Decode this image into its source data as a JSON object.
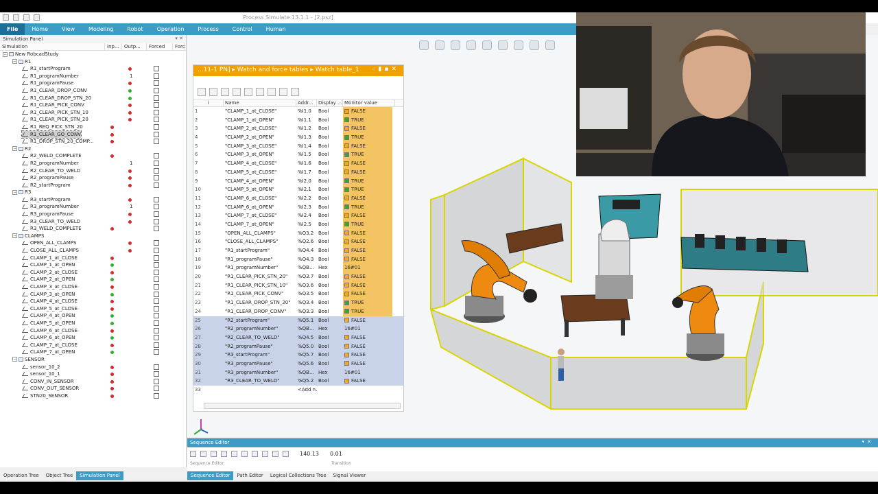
{
  "window": {
    "title": "Process Simulate 13.1.1 - [2.psz]"
  },
  "ribbon": {
    "tabs": [
      "File",
      "Home",
      "View",
      "Modeling",
      "Robot",
      "Operation",
      "Process",
      "Control",
      "Human"
    ]
  },
  "sim_panel": {
    "title": "Simulation Panel",
    "columns": [
      "Simulation",
      "Inp...",
      "Outp...",
      "Forced",
      "Forc"
    ],
    "rows": [
      {
        "label": "New RobcadStudy",
        "kind": "root",
        "indent": 0
      },
      {
        "label": "R1",
        "kind": "group",
        "indent": 1
      },
      {
        "label": "R1_startProgram",
        "kind": "sig",
        "indent": 2,
        "out": "red"
      },
      {
        "label": "R1_programNumber",
        "kind": "sig",
        "indent": 2,
        "num": "1"
      },
      {
        "label": "R1_programPause",
        "kind": "sig",
        "indent": 2,
        "out": "red"
      },
      {
        "label": "R1_CLEAR_DROP_CONV",
        "kind": "sig",
        "indent": 2,
        "out": "green"
      },
      {
        "label": "R1_CLEAR_DROP_STN_20",
        "kind": "sig",
        "indent": 2,
        "out": "green"
      },
      {
        "label": "R1_CLEAR_PICK_CONV",
        "kind": "sig",
        "indent": 2,
        "out": "red"
      },
      {
        "label": "R1_CLEAR_PICK_STN_10",
        "kind": "sig",
        "indent": 2,
        "out": "red"
      },
      {
        "label": "R1_CLEAR_PICK_STN_20",
        "kind": "sig",
        "indent": 2,
        "out": "red"
      },
      {
        "label": "R1_REQ_PICK_STN_20",
        "kind": "sig",
        "indent": 2,
        "in": "red"
      },
      {
        "label": "R1_CLEAR_GO_CONV",
        "kind": "sig",
        "indent": 2,
        "in": "red",
        "hl": true
      },
      {
        "label": "R1_DROP_STN_20_COMP...",
        "kind": "sig",
        "indent": 2,
        "in": "red"
      },
      {
        "label": "R2",
        "kind": "group",
        "indent": 1
      },
      {
        "label": "R2_WELD_COMPLETE",
        "kind": "sig",
        "indent": 2,
        "in": "red"
      },
      {
        "label": "R2_programNumber",
        "kind": "sig",
        "indent": 2,
        "num": "1"
      },
      {
        "label": "R2_CLEAR_TO_WELD",
        "kind": "sig",
        "indent": 2,
        "out": "red"
      },
      {
        "label": "R2_programPause",
        "kind": "sig",
        "indent": 2,
        "out": "red"
      },
      {
        "label": "R2_startProgram",
        "kind": "sig",
        "indent": 2,
        "out": "red"
      },
      {
        "label": "R3",
        "kind": "group",
        "indent": 1
      },
      {
        "label": "R3_startProgram",
        "kind": "sig",
        "indent": 2,
        "out": "red"
      },
      {
        "label": "R3_programNumber",
        "kind": "sig",
        "indent": 2,
        "num": "1"
      },
      {
        "label": "R3_programPause",
        "kind": "sig",
        "indent": 2,
        "out": "red"
      },
      {
        "label": "R3_CLEAR_TO_WELD",
        "kind": "sig",
        "indent": 2,
        "out": "red"
      },
      {
        "label": "R3_WELD_COMPLETE",
        "kind": "sig",
        "indent": 2,
        "in": "red"
      },
      {
        "label": "CLAMPS",
        "kind": "group",
        "indent": 1
      },
      {
        "label": "OPEN_ALL_CLAMPS",
        "kind": "sig",
        "indent": 2,
        "out": "red"
      },
      {
        "label": "CLOSE_ALL_CLAMPS",
        "kind": "sig",
        "indent": 2,
        "out": "red"
      },
      {
        "label": "CLAMP_1_at_CLOSE",
        "kind": "sig",
        "indent": 2,
        "in": "red"
      },
      {
        "label": "CLAMP_1_at_OPEN",
        "kind": "sig",
        "indent": 2,
        "in": "green"
      },
      {
        "label": "CLAMP_2_at_CLOSE",
        "kind": "sig",
        "indent": 2,
        "in": "red"
      },
      {
        "label": "CLAMP_2_at_OPEN",
        "kind": "sig",
        "indent": 2,
        "in": "green"
      },
      {
        "label": "CLAMP_3_at_CLOSE",
        "kind": "sig",
        "indent": 2,
        "in": "red"
      },
      {
        "label": "CLAMP_3_at_OPEN",
        "kind": "sig",
        "indent": 2,
        "in": "green"
      },
      {
        "label": "CLAMP_4_at_CLOSE",
        "kind": "sig",
        "indent": 2,
        "in": "red"
      },
      {
        "label": "CLAMP_5_at_CLOSE",
        "kind": "sig",
        "indent": 2,
        "in": "red"
      },
      {
        "label": "CLAMP_4_at_OPEN",
        "kind": "sig",
        "indent": 2,
        "in": "green"
      },
      {
        "label": "CLAMP_5_at_OPEN",
        "kind": "sig",
        "indent": 2,
        "in": "green"
      },
      {
        "label": "CLAMP_6_at_CLOSE",
        "kind": "sig",
        "indent": 2,
        "in": "red"
      },
      {
        "label": "CLAMP_6_at_OPEN",
        "kind": "sig",
        "indent": 2,
        "in": "green"
      },
      {
        "label": "CLAMP_7_at_CLOSE",
        "kind": "sig",
        "indent": 2,
        "in": "red"
      },
      {
        "label": "CLAMP_7_at_OPEN",
        "kind": "sig",
        "indent": 2,
        "in": "green"
      },
      {
        "label": "SENSOR",
        "kind": "group",
        "indent": 1
      },
      {
        "label": "sensor_10_2",
        "kind": "sig",
        "indent": 2,
        "in": "red"
      },
      {
        "label": "sensor_10_1",
        "kind": "sig",
        "indent": 2,
        "in": "red"
      },
      {
        "label": "CONV_IN_SENSOR",
        "kind": "sig",
        "indent": 2,
        "in": "red"
      },
      {
        "label": "CONV_OUT_SENSOR",
        "kind": "sig",
        "indent": 2,
        "in": "red"
      },
      {
        "label": "STN20_SENSOR",
        "kind": "sig",
        "indent": 2,
        "in": "red"
      }
    ],
    "bottom_tabs": [
      "Operation Tree",
      "Object Tree",
      "Simulation Panel"
    ]
  },
  "watch": {
    "title": "...11-1 PN]  ▸  Watch and force tables  ▸  Watch table_1",
    "columns": [
      "i",
      "Name",
      "Addr...",
      "Display ...",
      "Monitor value"
    ],
    "rows": [
      {
        "i": "1",
        "name": "\"CLAMP_1_at_CLOSE\"",
        "addr": "%I1.0",
        "disp": "Bool",
        "val": "FALSE",
        "style": "orange"
      },
      {
        "i": "2",
        "name": "\"CLAMP_1_at_OPEN\"",
        "addr": "%I1.1",
        "disp": "Bool",
        "val": "TRUE",
        "style": "orange"
      },
      {
        "i": "3",
        "name": "\"CLAMP_2_at_CLOSE\"",
        "addr": "%I1.2",
        "disp": "Bool",
        "val": "FALSE",
        "style": "orange"
      },
      {
        "i": "4",
        "name": "\"CLAMP_2_at_OPEN\"",
        "addr": "%I1.3",
        "disp": "Bool",
        "val": "TRUE",
        "style": "orange"
      },
      {
        "i": "5",
        "name": "\"CLAMP_3_at_CLOSE\"",
        "addr": "%I1.4",
        "disp": "Bool",
        "val": "FALSE",
        "style": "orange"
      },
      {
        "i": "6",
        "name": "\"CLAMP_3_at_OPEN\"",
        "addr": "%I1.5",
        "disp": "Bool",
        "val": "TRUE",
        "style": "orange"
      },
      {
        "i": "7",
        "name": "\"CLAMP_4_at_CLOSE\"",
        "addr": "%I1.6",
        "disp": "Bool",
        "val": "FALSE",
        "style": "orange"
      },
      {
        "i": "8",
        "name": "\"CLAMP_5_at_CLOSE\"",
        "addr": "%I1.7",
        "disp": "Bool",
        "val": "FALSE",
        "style": "orange"
      },
      {
        "i": "9",
        "name": "\"CLAMP_4_at_OPEN\"",
        "addr": "%I2.0",
        "disp": "Bool",
        "val": "TRUE",
        "style": "orange"
      },
      {
        "i": "10",
        "name": "\"CLAMP_5_at_OPEN\"",
        "addr": "%I2.1",
        "disp": "Bool",
        "val": "TRUE",
        "style": "orange"
      },
      {
        "i": "11",
        "name": "\"CLAMP_6_at_CLOSE\"",
        "addr": "%I2.2",
        "disp": "Bool",
        "val": "FALSE",
        "style": "orange"
      },
      {
        "i": "12",
        "name": "\"CLAMP_6_at_OPEN\"",
        "addr": "%I2.3",
        "disp": "Bool",
        "val": "TRUE",
        "style": "orange"
      },
      {
        "i": "13",
        "name": "\"CLAMP_7_at_CLOSE\"",
        "addr": "%I2.4",
        "disp": "Bool",
        "val": "FALSE",
        "style": "orange"
      },
      {
        "i": "14",
        "name": "\"CLAMP_7_at_OPEN\"",
        "addr": "%I2.5",
        "disp": "Bool",
        "val": "TRUE",
        "style": "orange"
      },
      {
        "i": "15",
        "name": "\"OPEN_ALL_CLAMPS\"",
        "addr": "%Q3.2",
        "disp": "Bool",
        "val": "FALSE",
        "style": "orange"
      },
      {
        "i": "16",
        "name": "\"CLOSE_ALL_CLAMPS\"",
        "addr": "%Q2.6",
        "disp": "Bool",
        "val": "FALSE",
        "style": "orange"
      },
      {
        "i": "17",
        "name": "\"R1_startProgram\"",
        "addr": "%Q4.4",
        "disp": "Bool",
        "val": "FALSE",
        "style": "orange"
      },
      {
        "i": "18",
        "name": "\"R1_programPause\"",
        "addr": "%Q4.3",
        "disp": "Bool",
        "val": "FALSE",
        "style": "orange"
      },
      {
        "i": "19",
        "name": "\"R1_programNumber\"",
        "addr": "%QB...",
        "disp": "Hex",
        "val": "16#01",
        "style": "orange"
      },
      {
        "i": "20",
        "name": "\"R1_CLEAR_PICK_STN_20\"",
        "addr": "%Q3.7",
        "disp": "Bool",
        "val": "FALSE",
        "style": "orange"
      },
      {
        "i": "21",
        "name": "\"R1_CLEAR_PICK_STN_10\"",
        "addr": "%Q3.6",
        "disp": "Bool",
        "val": "FALSE",
        "style": "orange"
      },
      {
        "i": "22",
        "name": "\"R1_CLEAR_PICK_CONV\"",
        "addr": "%Q3.5",
        "disp": "Bool",
        "val": "FALSE",
        "style": "orange"
      },
      {
        "i": "23",
        "name": "\"R1_CLEAR_DROP_STN_20\"",
        "addr": "%Q3.4",
        "disp": "Bool",
        "val": "TRUE",
        "style": "orange"
      },
      {
        "i": "24",
        "name": "\"R1_CLEAR_DROP_CONV\"",
        "addr": "%Q3.3",
        "disp": "Bool",
        "val": "TRUE",
        "style": "orange"
      },
      {
        "i": "25",
        "name": "\"R2_startProgram\"",
        "addr": "%Q5.1",
        "disp": "Bool",
        "val": "FALSE",
        "style": "blue"
      },
      {
        "i": "26",
        "name": "\"R2_programNumber\"",
        "addr": "%QB...",
        "disp": "Hex",
        "val": "16#01",
        "style": "blue"
      },
      {
        "i": "27",
        "name": "\"R2_CLEAR_TO_WELD\"",
        "addr": "%Q4.5",
        "disp": "Bool",
        "val": "FALSE",
        "style": "blue"
      },
      {
        "i": "28",
        "name": "\"R2_programPause\"",
        "addr": "%Q5.0",
        "disp": "Bool",
        "val": "FALSE",
        "style": "blue"
      },
      {
        "i": "29",
        "name": "\"R3_startProgram\"",
        "addr": "%Q5.7",
        "disp": "Bool",
        "val": "FALSE",
        "style": "blue"
      },
      {
        "i": "30",
        "name": "\"R3_programPause\"",
        "addr": "%Q5.6",
        "disp": "Bool",
        "val": "FALSE",
        "style": "blue"
      },
      {
        "i": "31",
        "name": "\"R3_programNumber\"",
        "addr": "%QB...",
        "disp": "Hex",
        "val": "16#01",
        "style": "blue"
      },
      {
        "i": "32",
        "name": "\"R3_CLEAR_TO_WELD\"",
        "addr": "%Q5.2",
        "disp": "Bool",
        "val": "FALSE",
        "style": "blue"
      },
      {
        "i": "33",
        "name": "",
        "addr": "<Add n...",
        "disp": "",
        "val": "",
        "style": "plain"
      }
    ]
  },
  "sequence": {
    "title": "Sequence Editor",
    "time": "140.13",
    "step": "0.01",
    "col_a": "Sequence Editor",
    "col_b": "Transition"
  },
  "bottom_tabs_right": [
    "Sequence Editor",
    "Path Editor",
    "Logical Collections Tree",
    "Signal Viewer"
  ],
  "colors": {
    "ribbon": "#3d9cc6",
    "watch_accent": "#f2a000",
    "signal_red": "#d62b2b",
    "signal_green": "#2fb02f"
  }
}
